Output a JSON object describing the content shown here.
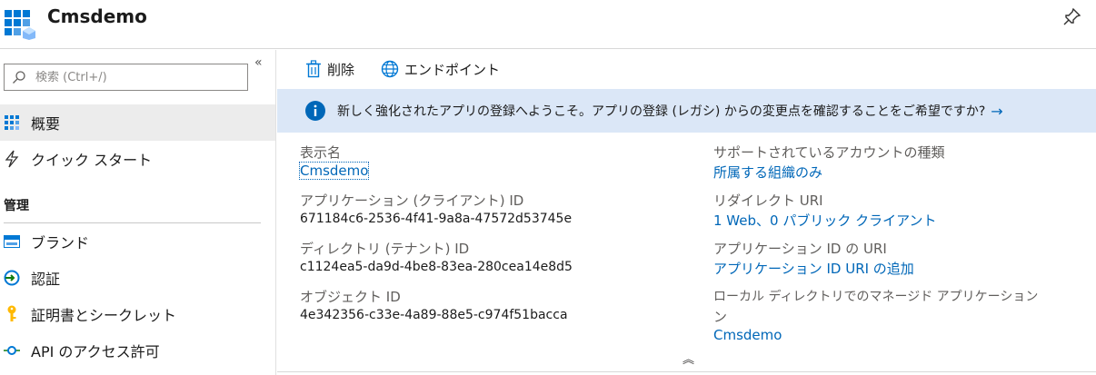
{
  "header": {
    "title": "Cmsdemo",
    "icons": {
      "app": "app-registration-icon",
      "pin": "pin-icon"
    }
  },
  "sidebar": {
    "collapse_glyph": "«",
    "search": {
      "placeholder": "検索 (Ctrl+/)",
      "value": ""
    },
    "items": [
      {
        "label": "概要",
        "icon": "overview-grid-icon",
        "active": true
      },
      {
        "label": "クイック スタート",
        "icon": "lightning-icon",
        "active": false
      }
    ],
    "section_title": "管理",
    "manage_items": [
      {
        "label": "ブランド",
        "icon": "branding-icon"
      },
      {
        "label": "認証",
        "icon": "authentication-icon"
      },
      {
        "label": "証明書とシークレット",
        "icon": "key-icon"
      },
      {
        "label": "API のアクセス許可",
        "icon": "api-permissions-icon"
      }
    ]
  },
  "toolbar": {
    "delete_label": "削除",
    "endpoints_label": "エンドポイント"
  },
  "banner": {
    "text": "新しく強化されたアプリの登録へようこそ。アプリの登録 (レガシ) からの変更点を確認することをご希望ですか?",
    "arrow": "→"
  },
  "essentials": {
    "left": [
      {
        "label": "表示名",
        "value": "Cmsdemo",
        "is_link": true
      },
      {
        "label": "アプリケーション (クライアント) ID",
        "value": "671184c6-2536-4f41-9a8a-47572d53745e",
        "is_link": false
      },
      {
        "label": "ディレクトリ (テナント) ID",
        "value": "c1124ea5-da9d-4be8-83ea-280cea14e8d5",
        "is_link": false
      },
      {
        "label": "オブジェクト ID",
        "value": "4e342356-c33e-4a89-88e5-c974f51bacca",
        "is_link": false
      }
    ],
    "right": [
      {
        "label": "サポートされているアカウントの種類",
        "value": "所属する組織のみ",
        "is_link": true
      },
      {
        "label": "リダイレクト URI",
        "value": "1 Web、0 パブリック クライアント",
        "is_link": true
      },
      {
        "label": "アプリケーション ID の URI",
        "value": "アプリケーション ID URI の追加",
        "is_link": true
      },
      {
        "label": "ローカル ディレクトリでのマネージド アプリケーション",
        "label_cont": "ン",
        "value": "Cmsdemo",
        "is_link": true
      }
    ],
    "collapse_glyph": "︽"
  },
  "colors": {
    "accent": "#0067b8",
    "banner_bg": "#dbe7f7",
    "active_nav_bg": "#ececec",
    "label_gray": "#605e5c"
  }
}
